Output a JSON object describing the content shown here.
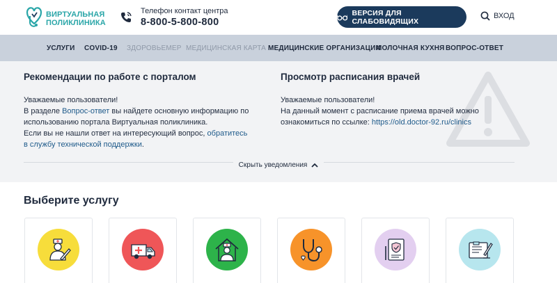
{
  "header": {
    "logo_line1": "ВИРТУАЛЬНАЯ",
    "logo_line2": "ПОЛИКЛИНИКА",
    "phone_caption": "Телефон контакт центра",
    "phone_number": "8-800-5-800-800",
    "vision_button": "ВЕРСИЯ ДЛЯ СЛАБОВИДЯЩИХ",
    "login": "ВХОД"
  },
  "nav": {
    "items": [
      {
        "label": "УСЛУГИ"
      },
      {
        "label": "COVID-19"
      },
      {
        "label": "ЗДОРОВЬЕМЕР"
      },
      {
        "label": "МЕДИЦИНСКАЯ КАРТА"
      },
      {
        "label": "МЕДИЦИНСКИЕ ОРГАНИЗАЦИИ"
      },
      {
        "label": "МОЛОЧНАЯ КУХНЯ"
      },
      {
        "label": "ВОПРОС-ОТВЕТ"
      }
    ]
  },
  "notice": {
    "left": {
      "title": "Рекомендации по работе с порталом",
      "greeting": "Уважаемые пользователи!",
      "p1_a": "В разделе ",
      "p1_link": "Вопрос-ответ",
      "p1_b": " вы найдете основную информацию по использованию портала Виртуальная поликлиника.",
      "p2_a": "Если вы не нашли ответ на интересующий вопрос, ",
      "p2_link": "обратитесь в службу технической поддержки",
      "p2_b": "."
    },
    "right": {
      "title": "Просмотр расписания врачей",
      "greeting": "Уважаемые пользователи!",
      "p1": "На данный момент с расписание приема врачей можно ознакомиться по ссылке: ",
      "p1_link": "https://old.doctor-92.ru/clinics"
    },
    "hide_label": "Скрыть уведомления"
  },
  "services": {
    "title": "Выберите услугу"
  },
  "colors": {
    "brand": "#2aa6a8",
    "dark_button": "#1b3a5c",
    "nav_bg": "#c9d1dc",
    "card1": "#f7dd3b",
    "card2": "#ef5658",
    "card3": "#2db34a",
    "card4": "#f7932a",
    "card5": "#e3cff0",
    "card6": "#b7e6ee"
  }
}
